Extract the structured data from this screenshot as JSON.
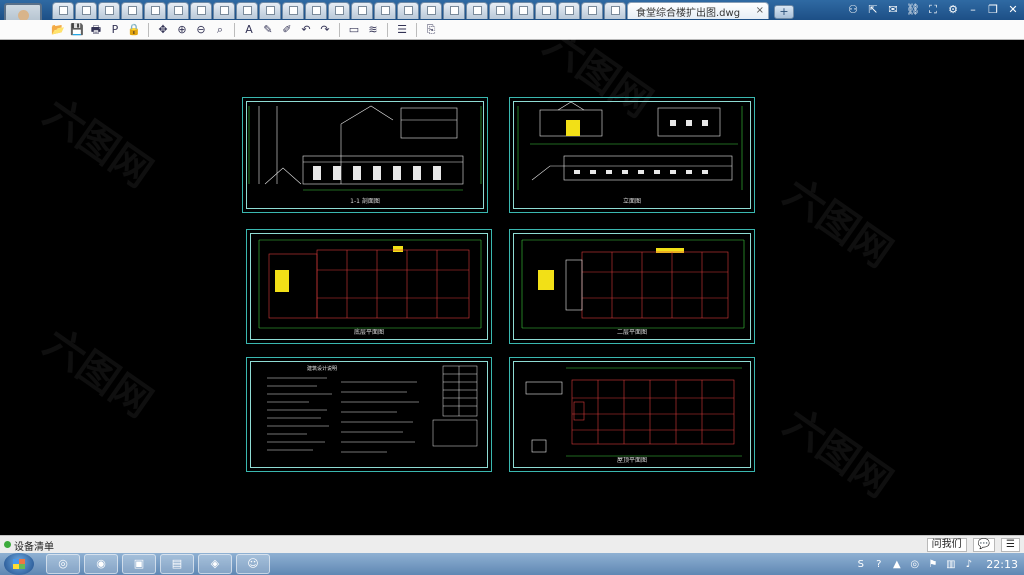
{
  "tabbar": {
    "tab_count": 25,
    "active_tab_title": "食堂综合楼扩出图.dwg",
    "close_glyph": "×",
    "add_glyph": "+",
    "sys_icons": [
      "people-icon",
      "share-icon",
      "chat-icon",
      "link-icon",
      "fullscreen-icon",
      "settings-icon",
      "minimize-icon",
      "restore-icon",
      "close-icon"
    ],
    "sys_glyphs": [
      "⚇",
      "⇱",
      "✉",
      "⛓",
      "⛶",
      "⚙",
      "–",
      "❐",
      "✕"
    ]
  },
  "toolbar": {
    "buttons": [
      {
        "name": "open-icon",
        "glyph": "📂"
      },
      {
        "name": "save-icon",
        "glyph": "💾"
      },
      {
        "name": "print-icon",
        "glyph": "🖶"
      },
      {
        "name": "pdf-icon",
        "glyph": "P"
      },
      {
        "name": "lock-icon",
        "glyph": "🔒"
      },
      {
        "name": "sep"
      },
      {
        "name": "pan-icon",
        "glyph": "✥"
      },
      {
        "name": "zoom-in-icon",
        "glyph": "⊕"
      },
      {
        "name": "zoom-out-icon",
        "glyph": "⊖"
      },
      {
        "name": "zoom-window-icon",
        "glyph": "⌕"
      },
      {
        "name": "sep"
      },
      {
        "name": "text-icon",
        "glyph": "A"
      },
      {
        "name": "pencil-icon",
        "glyph": "✎"
      },
      {
        "name": "highlighter-icon",
        "glyph": "✐"
      },
      {
        "name": "undo-icon",
        "glyph": "↶"
      },
      {
        "name": "redo-icon",
        "glyph": "↷"
      },
      {
        "name": "sep"
      },
      {
        "name": "measure-icon",
        "glyph": "▭"
      },
      {
        "name": "dimension-icon",
        "glyph": "≋"
      },
      {
        "name": "sep"
      },
      {
        "name": "layers-icon",
        "glyph": "☰"
      },
      {
        "name": "sep"
      },
      {
        "name": "export-icon",
        "glyph": "⎘"
      }
    ]
  },
  "sheets": [
    {
      "label": "1-1 剖面图"
    },
    {
      "label": "立面图"
    },
    {
      "label": "底层平面图"
    },
    {
      "label": "二层平面图"
    },
    {
      "label": "建筑设计说明"
    },
    {
      "label": "屋顶平面图"
    }
  ],
  "watermark": "六图网",
  "statusbar": {
    "text": "设备清单",
    "right_items": [
      "问我们",
      "💬",
      "☰"
    ]
  },
  "taskbar": {
    "tasks": [
      "◎",
      "◉",
      "▣",
      "▤",
      "◈",
      "☺"
    ],
    "tray": [
      "S",
      "?",
      "▲",
      "◎",
      "⚑",
      "▥",
      "♪"
    ],
    "clock": "22:13"
  },
  "colors": {
    "sheet_frame": "#3ab7b0",
    "cad_line": "#e8e8e8",
    "cad_red": "#d83a3a",
    "cad_green": "#3fcf3f",
    "cad_yellow": "#f2e017"
  }
}
